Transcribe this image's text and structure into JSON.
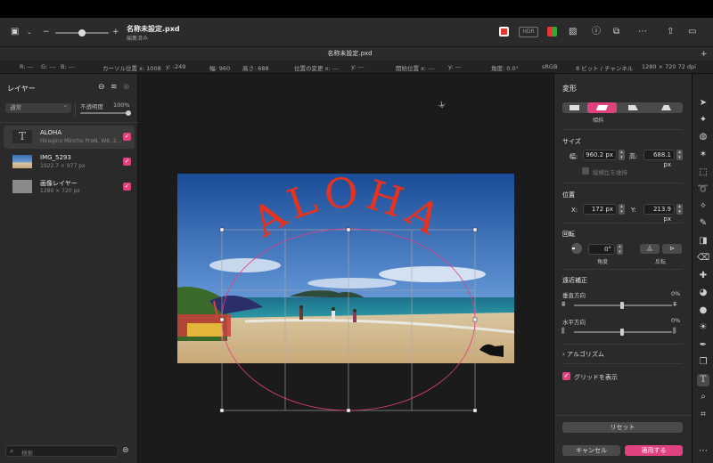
{
  "document": {
    "title": "名称未設定.pxd",
    "subtitle": "編集済み",
    "tab": "名称未設定.pxd"
  },
  "toolbar": {
    "hdr_label": "HDR"
  },
  "info": {
    "r": "R: ---",
    "g": "G: ---",
    "b": "B: ---",
    "cursor_x": "カーソル位置 x: 1008",
    "cursor_y": "y: -249",
    "width": "幅: 960",
    "height": "高さ: 688",
    "pos_change_x": "位置の変更 x: ---",
    "pos_change_y": "y: ---",
    "start_x": "開始位置 x: ---",
    "start_y": "y: ---",
    "angle": "角度: 0.0°",
    "colorspace": "sRGB",
    "bits": "8 ビット / チャンネル",
    "docsize": "1280 × 720 72 dpi"
  },
  "layers_panel": {
    "title": "レイヤー",
    "blend_mode": "通常",
    "opacity_label": "不透明度",
    "opacity_value": "100%",
    "opacity": 1.0,
    "items": [
      {
        "name": "ALOHA",
        "detail": "Hiragino Mincho ProN, W6, 2...",
        "type": "text"
      },
      {
        "name": "IMG_5293",
        "detail": "1922.7 × 977 px",
        "type": "image"
      },
      {
        "name": "画像レイヤー",
        "detail": "1280 × 720 px",
        "type": "image"
      }
    ],
    "search_placeholder": "検索"
  },
  "canvas": {
    "text": "ALOHA",
    "text_color": "#e8321e"
  },
  "transform": {
    "title": "変形",
    "mode_caption": "傾斜",
    "size_title": "サイズ",
    "width_label": "幅:",
    "width_value": "960.2 px",
    "height_label": "高:",
    "height_value": "688.1 px",
    "keep_ratio": "縦横比を維持",
    "position_title": "位置",
    "x_label": "X:",
    "x_value": "172 px",
    "y_label": "Y:",
    "y_value": "213.9 px",
    "rotate_title": "回転",
    "angle_value": "0°",
    "angle_caption": "角度",
    "flip_caption": "反転",
    "perspective_title": "遠近補正",
    "vertical_label": "垂直方向",
    "vertical_value": "0%",
    "horizontal_label": "水平方向",
    "horizontal_value": "0%",
    "algorithm_label": "アルゴリズム",
    "grid_label": "グリッドを表示",
    "reset_label": "リセット",
    "cancel_label": "キャンセル",
    "apply_label": "適用する"
  },
  "colors": {
    "accent": "#e0417f",
    "text_red": "#e8321e"
  }
}
